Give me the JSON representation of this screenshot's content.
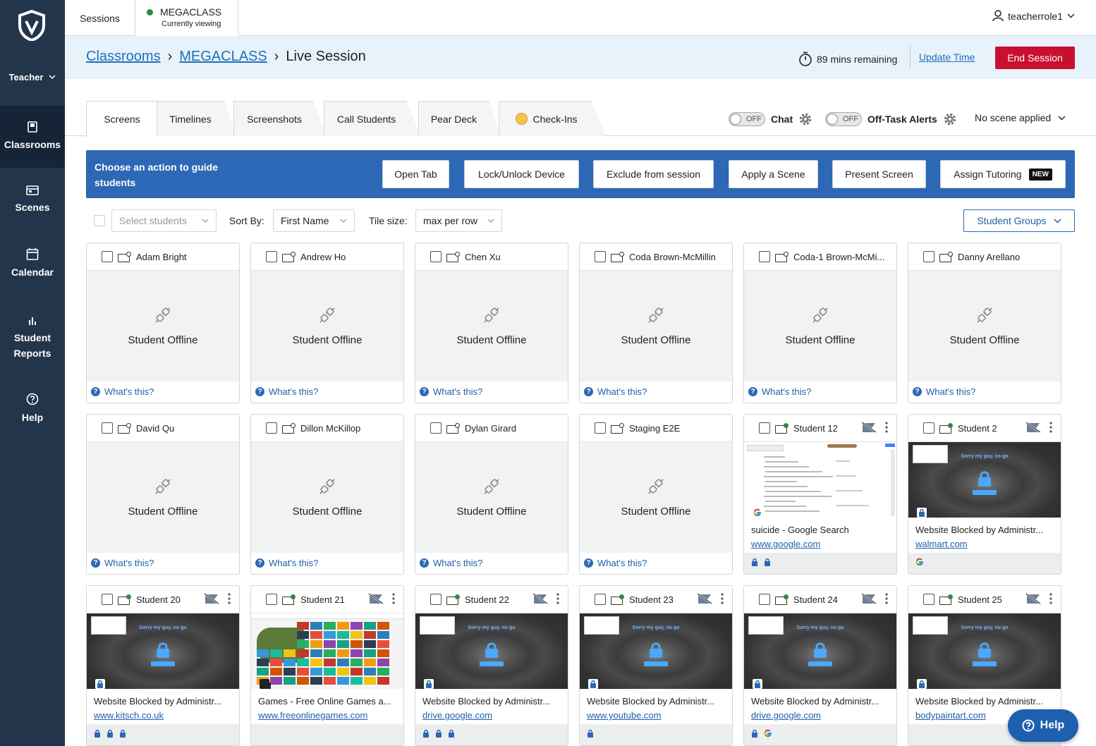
{
  "sidebar": {
    "role": "Teacher",
    "items": [
      {
        "label": "Classrooms",
        "icon": "book-icon"
      },
      {
        "label": "Scenes",
        "icon": "scenes-icon"
      },
      {
        "label": "Calendar",
        "icon": "calendar-icon"
      },
      {
        "label": "Student Reports",
        "icon": "bar-chart-icon"
      },
      {
        "label": "Help",
        "icon": "question-circle-icon"
      }
    ]
  },
  "topbar": {
    "sessions": "Sessions",
    "class_name": "MEGACLASS",
    "class_status": "Currently viewing",
    "user": "teacherrole1"
  },
  "breadcrumb": {
    "classrooms": "Classrooms",
    "class": "MEGACLASS",
    "current": "Live Session",
    "sep": "›"
  },
  "session": {
    "remaining": "89 mins remaining",
    "update": "Update Time",
    "end": "End Session"
  },
  "tabs": [
    "Screens",
    "Timelines",
    "Screenshots",
    "Call Students",
    "Pear Deck",
    "Check-Ins"
  ],
  "toggles": {
    "state": "OFF",
    "chat": "Chat",
    "offtask": "Off-Task Alerts",
    "scene": "No scene applied"
  },
  "actions": {
    "prompt": "Choose an action to guide students",
    "buttons": [
      "Open Tab",
      "Lock/Unlock Device",
      "Exclude from session",
      "Apply a Scene",
      "Present Screen",
      "Assign Tutoring"
    ],
    "new_badge": "NEW"
  },
  "filters": {
    "select_placeholder": "Select students",
    "sort_label": "Sort By:",
    "sort_value": "First Name",
    "tile_label": "Tile size:",
    "tile_value": "max per row",
    "groups": "Student Groups"
  },
  "offline_text": "Student Offline",
  "whats_this": "What's this?",
  "help_button": "Help",
  "students": [
    {
      "name": "Adam Bright",
      "online": false
    },
    {
      "name": "Andrew Ho",
      "online": false
    },
    {
      "name": "Chen Xu",
      "online": false
    },
    {
      "name": "Coda Brown-McMillin",
      "online": false
    },
    {
      "name": "Coda-1 Brown-McMi...",
      "online": false
    },
    {
      "name": "Danny Arellano",
      "online": false
    },
    {
      "name": "David Qu",
      "online": false
    },
    {
      "name": "Dillon McKillop",
      "online": false
    },
    {
      "name": "Dylan Girard",
      "online": false
    },
    {
      "name": "Staging E2E",
      "online": false
    },
    {
      "name": "Student 12",
      "online": true,
      "shot": "search",
      "title": "suicide - Google Search",
      "url": "www.google.com",
      "footer": [
        "lock",
        "lock"
      ]
    },
    {
      "name": "Student 2",
      "online": true,
      "shot": "blocked",
      "title": "Website Blocked by Administr...",
      "url": "walmart.com",
      "footer": [
        "google"
      ]
    },
    {
      "name": "Student 20",
      "online": true,
      "shot": "blocked",
      "title": "Website Blocked by Administr...",
      "url": "www.kitsch.co.uk",
      "footer": [
        "lock",
        "lock",
        "lock"
      ]
    },
    {
      "name": "Student 21",
      "online": true,
      "shot": "games",
      "title": "Games - Free Online Games a...",
      "url": "www.freeonlinegames.com",
      "footer": []
    },
    {
      "name": "Student 22",
      "online": true,
      "shot": "blocked",
      "title": "Website Blocked by Administr...",
      "url": "drive.google.com",
      "footer": [
        "lock",
        "lock",
        "lock"
      ]
    },
    {
      "name": "Student 23",
      "online": true,
      "shot": "blocked",
      "title": "Website Blocked by Administr...",
      "url": "www.youtube.com",
      "footer": [
        "lock"
      ]
    },
    {
      "name": "Student 24",
      "online": true,
      "shot": "blocked",
      "title": "Website Blocked by Administr...",
      "url": "drive.google.com",
      "footer": [
        "lock",
        "google"
      ]
    },
    {
      "name": "Student 25",
      "online": true,
      "shot": "blocked",
      "title": "Website Blocked by Administr...",
      "url": "bodypaintart.com",
      "footer": []
    }
  ],
  "blocked_banner": "Sorry my guy, no go",
  "colors": {
    "sidebar": "#23354a",
    "accent": "#2c68b5",
    "danger": "#c8102e",
    "online": "#2e8b3f"
  }
}
